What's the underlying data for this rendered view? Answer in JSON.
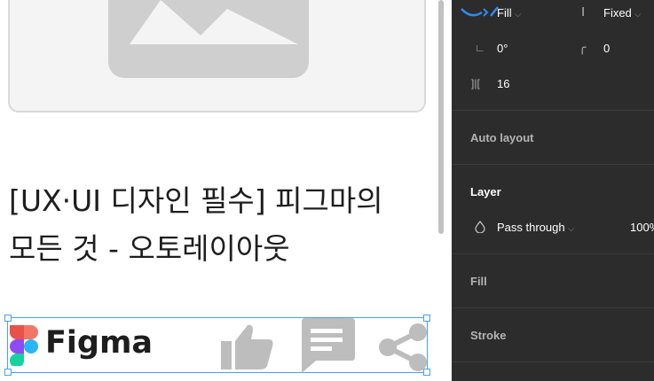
{
  "title": {
    "line1": "[UX·UI 디자인 필수] 피그마의",
    "line2": "모든 것 - 오토레이아웃"
  },
  "brand": {
    "name": "Figma"
  },
  "panel": {
    "width_mode": "Fill",
    "height_mode": "Fixed",
    "rotation": "0°",
    "corner_radius": "0",
    "spacing": "16",
    "auto_layout": "Auto layout",
    "layer": {
      "heading": "Layer",
      "blend_mode": "Pass through",
      "opacity": "100%"
    },
    "fill": "Fill",
    "stroke": "Stroke"
  },
  "icons": {
    "figma_logo": "figma-logo-icon",
    "like": "thumbs-up-icon",
    "comment": "comment-icon",
    "share": "share-icon",
    "image": "image-placeholder-icon"
  },
  "colors": {
    "panel_bg": "#2c2c2c",
    "selection": "#4aa0f0",
    "icon_gray": "#bdbdbd"
  }
}
